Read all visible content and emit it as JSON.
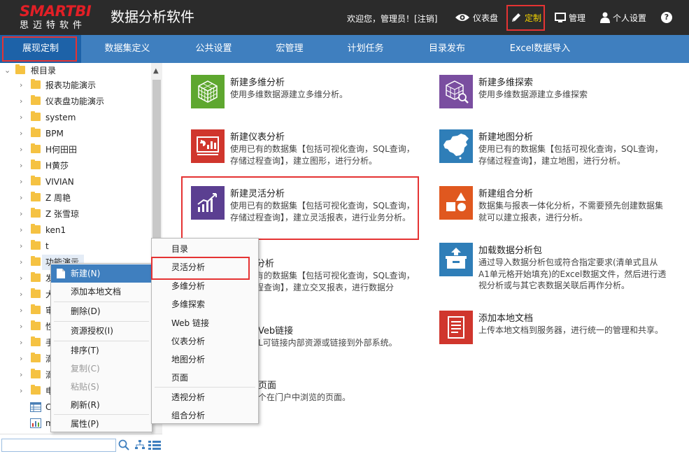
{
  "header": {
    "logo_main": "SMARTBI",
    "logo_sub": "思迈特软件",
    "app_title": "数据分析软件",
    "welcome": "欢迎您，管理员！[",
    "logout": "注销",
    "welcome_end": "]",
    "nav": {
      "dashboard": "仪表盘",
      "customize": "定制",
      "manage": "管理",
      "personal": "个人设置",
      "help": "?"
    }
  },
  "navbar": {
    "tabs": [
      "展现定制",
      "数据集定义",
      "公共设置",
      "宏管理",
      "计划任务",
      "目录发布",
      "Excel数据导入"
    ]
  },
  "tree": {
    "root": "根目录",
    "items": [
      "报表功能演示",
      "仪表盘功能演示",
      "system",
      "BPM",
      "H何田田",
      "H黄莎",
      "VIVIAN",
      "Z 周艳",
      "Z 张雪琼",
      "ken1",
      "t",
      "功能演示",
      "发",
      "大",
      "审",
      "性",
      "手",
      "滴",
      "滴",
      "电",
      "C",
      "m"
    ]
  },
  "cards": [
    {
      "title": "新建多维分析",
      "desc": "使用多维数据源建立多维分析。",
      "color": "#5ea72f",
      "icon": "cube-icon"
    },
    {
      "title": "新建多维探索",
      "desc": "使用多维数据源建立多维探索",
      "color": "#7a4ea0",
      "icon": "cube-search-icon"
    },
    {
      "title": "新建仪表分析",
      "desc": "使用已有的数据集【包括可视化查询，SQL查询，存储过程查询】，建立图形，进行分析。",
      "color": "#d0362d",
      "icon": "dashboard-icon"
    },
    {
      "title": "新建地图分析",
      "desc": "使用已有的数据集【包括可视化查询，SQL查询，存储过程查询】，建立地图，进行分析。",
      "color": "#2f7eb8",
      "icon": "china-map-icon"
    },
    {
      "title": "新建灵活分析",
      "desc": "使用已有的数据集【包括可视化查询，SQL查询，存储过程查询】，建立灵活报表，进行业务分析。",
      "color": "#5b3f91",
      "icon": "bar-chart-icon"
    },
    {
      "title": "新建组合分析",
      "desc": "数据集与报表一体化分析，不需要预先创建数据集就可以建立报表，进行分析。",
      "color": "#e0581f",
      "icon": "shapes-icon"
    },
    {
      "title": "视分析",
      "desc": "使用已有的数据集【包括可视化查询，SQL查询，存储过程查询】，建立交叉报表，进行数据分",
      "color": "#ffffff",
      "icon": ""
    },
    {
      "title": "加载数据分析包",
      "desc": "通过导入数据分析包或符合指定要求(清单式且从A1单元格开始填充)的Excel数据文件，然后进行透视分析或与其它表数据关联后再作分析。",
      "color": "#2f7eb8",
      "icon": "package-upload-icon"
    },
    {
      "title": "Veb链接",
      "desc": "L可链接内部资源或链接到外部系统。",
      "color": "#ffffff",
      "icon": ""
    },
    {
      "title": "添加本地文档",
      "desc": "上传本地文档到服务器，进行统一的管理和共享。",
      "color": "#d0362d",
      "icon": "document-icon"
    },
    {
      "title": "页面",
      "desc": "个在门户中浏览的页面。",
      "color": "#ffffff",
      "icon": ""
    }
  ],
  "context_menu": {
    "items": [
      "新建(N)",
      "添加本地文档",
      "删除(D)",
      "资源授权(I)",
      "排序(T)",
      "复制(C)",
      "粘贴(S)",
      "刷新(R)",
      "属性(P)"
    ],
    "disabled": [
      false,
      false,
      false,
      false,
      false,
      true,
      true,
      false,
      false
    ]
  },
  "submenu": {
    "items": [
      "目录",
      "灵活分析",
      "多维分析",
      "多维探索",
      "Web 链接",
      "仪表分析",
      "地图分析",
      "页面",
      "透视分析",
      "组合分析"
    ]
  },
  "colors": {
    "header_bg": "#2b2b2b",
    "nav_bg": "#3f7fbf",
    "nav_active": "#1d62a8",
    "highlight": "#e53333",
    "customize": "#f5d400"
  }
}
